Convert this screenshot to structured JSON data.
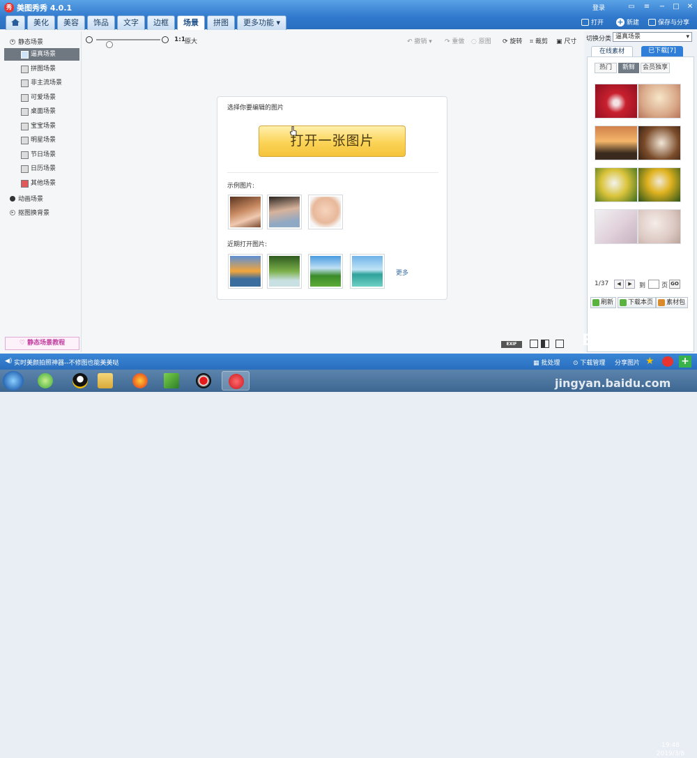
{
  "app": {
    "title": "美图秀秀 4.0.1",
    "logo": "秀",
    "login": "登录"
  },
  "window_controls": [
    "-",
    "▭",
    "□",
    "✕"
  ],
  "top_actions": {
    "open": "打开",
    "new": "新建",
    "save": "保存与分享"
  },
  "tabs": [
    "美化",
    "美容",
    "饰品",
    "文字",
    "边框",
    "场景",
    "拼图",
    "更多功能"
  ],
  "active_tab": "场景",
  "sidebar": {
    "group1": "静态场景",
    "items": [
      "逼真场景",
      "拼图场景",
      "非主流场景",
      "可爱场景",
      "桌面场景",
      "宝宝场景",
      "明星场景",
      "节日场景",
      "日历场景",
      "其他场景"
    ],
    "selected": "逼真场景",
    "group2": "动画场景",
    "group3": "抠图换背景",
    "tutorial": "静态场景教程"
  },
  "toolbar": {
    "ratio": "1:1",
    "original": "原大",
    "undo": "撤销",
    "redo": "重做",
    "reset": "原图",
    "rotate": "旋转",
    "crop": "裁剪",
    "size": "尺寸"
  },
  "card": {
    "prompt": "选择你要编辑的图片",
    "open_button": "打开一张图片",
    "sample_label": "示例图片:",
    "recent_label": "近期打开图片:",
    "more": "更多"
  },
  "right_panel": {
    "switch_label": "切换分类",
    "category": "逼真场景",
    "tab_online": "在线素材",
    "tab_downloaded": "已下载[7]",
    "subtabs": [
      "热门",
      "新鲜",
      "会员独享"
    ],
    "selected_subtab": "新鲜",
    "page": "1/37",
    "to": "到",
    "page_unit": "页",
    "go": "GO",
    "refresh": "刷新",
    "download_page": "下载本页",
    "package": "素材包"
  },
  "status": {
    "message": "实时美颜拍照神器--不修图也能美美哒",
    "batch": "批处理",
    "download_mgr": "下载管理",
    "share": "分享图片"
  },
  "exif": "EXIF",
  "clock": {
    "time": "19:48",
    "date": "2019/3/8"
  },
  "watermark": {
    "site": "jingyan.baidu.com",
    "logo": "Bai du 经验"
  }
}
